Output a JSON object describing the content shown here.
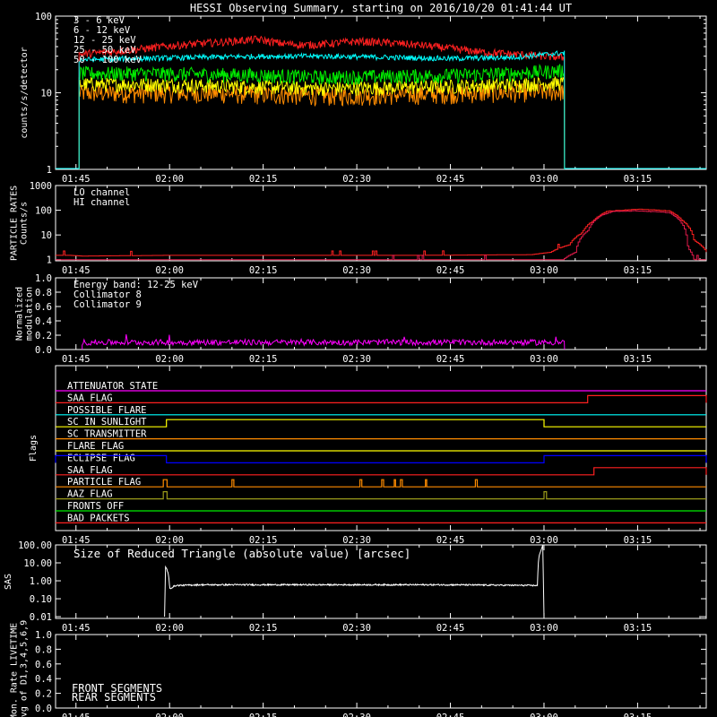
{
  "title": "HESSI Observing Summary, starting on 2016/10/20 01:41:44 UT",
  "colors": {
    "red": "#ff2020",
    "orange": "#ff8c00",
    "yellow": "#ffff00",
    "green": "#00ee00",
    "cyan": "#00ffff",
    "magenta": "#ff00ff",
    "blue": "#0000ff",
    "olive": "#9a9a1a",
    "crimson": "#e01a4a",
    "white": "#ffffff"
  },
  "time_axis": {
    "ticks": [
      "01:45",
      "02:00",
      "02:15",
      "02:30",
      "02:45",
      "03:00",
      "03:15"
    ],
    "tick_minutes": [
      105,
      120,
      135,
      150,
      165,
      180,
      195
    ],
    "range_minutes": [
      101.73,
      206
    ]
  },
  "chart_data": [
    {
      "id": "count-rates",
      "type": "line",
      "ylabel": "counts/s/detector",
      "yscale": "log",
      "ylim": [
        1,
        100
      ],
      "yticks": [
        "100",
        "10",
        "1"
      ],
      "yvals": [
        100,
        10,
        1
      ],
      "observing_window": [
        105.5,
        183.3
      ],
      "series": [
        {
          "name": "3 - 6 keV",
          "color": "red",
          "x": [
            106,
            110,
            115,
            120,
            125,
            130,
            134,
            138,
            142,
            146,
            150,
            155,
            160,
            165,
            170,
            175,
            180,
            183
          ],
          "y": [
            32,
            34,
            37,
            41,
            44,
            47,
            50,
            44,
            42,
            44,
            47,
            45,
            42,
            38,
            34,
            32,
            30,
            29
          ]
        },
        {
          "name": "6 - 12 keV",
          "color": "orange",
          "x": [
            106,
            115,
            125,
            135,
            145,
            155,
            165,
            175,
            183
          ],
          "y": [
            10,
            10,
            10,
            9.6,
            9.2,
            9.4,
            9.8,
            10.2,
            10.5
          ]
        },
        {
          "name": "12 - 25 keV",
          "color": "yellow",
          "x": [
            106,
            115,
            125,
            135,
            145,
            155,
            165,
            175,
            183
          ],
          "y": [
            13,
            13,
            12.5,
            12,
            11.5,
            11.8,
            12.2,
            12.8,
            13.5
          ]
        },
        {
          "name": "25 - 50 keV",
          "color": "green",
          "x": [
            106,
            115,
            125,
            135,
            145,
            155,
            165,
            175,
            183
          ],
          "y": [
            18,
            18,
            17.5,
            17,
            16,
            16.5,
            17,
            18,
            19.5
          ]
        },
        {
          "name": "50 - 100 keV",
          "color": "cyan",
          "x": [
            106,
            115,
            125,
            135,
            145,
            155,
            165,
            175,
            183
          ],
          "y": [
            27,
            28,
            29,
            30,
            30,
            29,
            28,
            29,
            33
          ]
        }
      ]
    },
    {
      "id": "particle-rates",
      "type": "line",
      "ylabel": "PARTICLE RATES Counts/s",
      "yscale": "log",
      "ylim": [
        0.9,
        1000
      ],
      "yticks": [
        "1000",
        "100",
        "10",
        "1"
      ],
      "yvals": [
        1000,
        100,
        10,
        1
      ],
      "series": [
        {
          "name": "LO channel",
          "color": "red",
          "x": [
            101.73,
            104,
            106,
            120,
            140,
            160,
            178,
            181,
            184,
            186,
            188,
            190,
            195,
            200,
            202,
            204,
            206
          ],
          "y": [
            1.5,
            1.5,
            1.4,
            1.5,
            1.5,
            1.5,
            1.6,
            2,
            4,
            12,
            40,
            90,
            110,
            95,
            40,
            6,
            2
          ]
        },
        {
          "name": "HI channel",
          "color": "crimson",
          "x": [
            101.73,
            104,
            106,
            120,
            140,
            160,
            180,
            183,
            185,
            187,
            189,
            191,
            195,
            200,
            202,
            203,
            204,
            206
          ],
          "y": [
            1,
            1,
            1,
            1,
            1,
            1,
            1,
            1,
            2,
            15,
            60,
            90,
            95,
            80,
            30,
            3,
            1,
            1
          ]
        }
      ]
    },
    {
      "id": "modulation",
      "type": "line",
      "ylabel": "Normalized modulation",
      "ylim": [
        0,
        1
      ],
      "yticks": [
        "1.0",
        "0.8",
        "0.6",
        "0.4",
        "0.2",
        "0.0"
      ],
      "yvals": [
        1,
        0.8,
        0.6,
        0.4,
        0.2,
        0
      ],
      "annotation": "Energy band: 12-25 keV",
      "series": [
        {
          "name": "Collimator 8",
          "color": "cyan",
          "x": [],
          "y": []
        },
        {
          "name": "Collimator 9",
          "color": "magenta",
          "x": [
            106,
            183.3
          ],
          "y": [
            0.1,
            0.1
          ]
        }
      ]
    },
    {
      "id": "flags",
      "type": "line",
      "ylabel": "Flags",
      "flags": [
        {
          "name": "ATTENUATOR STATE",
          "color": "magenta",
          "segments": []
        },
        {
          "name": "SAA FLAG",
          "color": "red",
          "segments": [
            [
              187,
              206
            ]
          ]
        },
        {
          "name": "POSSIBLE FLARE",
          "color": "cyan",
          "segments": []
        },
        {
          "name": "SC IN SUNLIGHT",
          "color": "yellow",
          "segments": [
            [
              119.5,
              180
            ]
          ]
        },
        {
          "name": "SC TRANSMITTER",
          "color": "orange",
          "segments": []
        },
        {
          "name": "FLARE FLAG",
          "color": "yellow",
          "segments": []
        },
        {
          "name": "ECLIPSE FLAG",
          "color": "blue",
          "segments": [
            [
              101.73,
              119.5
            ],
            [
              180,
              206
            ]
          ]
        },
        {
          "name": "SAA FLAG",
          "color": "red",
          "segments": [
            [
              188,
              206
            ]
          ]
        },
        {
          "name": "PARTICLE FLAG",
          "color": "orange",
          "segments": [
            [
              119,
              119.6
            ],
            [
              130,
              130.3
            ],
            [
              150.5,
              150.8
            ],
            [
              154,
              154.3
            ],
            [
              156,
              156.2
            ],
            [
              157,
              157.3
            ],
            [
              161,
              161.2
            ],
            [
              169,
              169.3
            ]
          ]
        },
        {
          "name": "AAZ FLAG",
          "color": "olive",
          "segments": [
            [
              119,
              119.6
            ],
            [
              180,
              180.4
            ]
          ]
        },
        {
          "name": "FRONTS OFF",
          "color": "green",
          "segments": []
        },
        {
          "name": "BAD PACKETS",
          "color": "red",
          "segments": []
        }
      ]
    },
    {
      "id": "sas",
      "type": "line",
      "ylabel": "SAS",
      "yscale": "log",
      "ylim": [
        0.008,
        100
      ],
      "yticks": [
        "100.00",
        "10.00",
        "1.00",
        "0.10",
        "0.01"
      ],
      "yvals": [
        100,
        10,
        1,
        0.1,
        0.01
      ],
      "series": [
        {
          "name": "Size of Reduced Triangle (absolute value) [arcsec]",
          "color": "white",
          "x": [
            119.3,
            119.5,
            120,
            121,
            125,
            135,
            150,
            165,
            179,
            180
          ],
          "y": [
            0.01,
            5,
            0.35,
            0.55,
            0.6,
            0.6,
            0.6,
            0.6,
            0.55,
            100
          ]
        }
      ]
    },
    {
      "id": "livetime",
      "type": "line",
      "ylabel": "Mon. Rate LIVETIME avg of D1,3,4,5,6,9",
      "ylim": [
        0,
        1
      ],
      "yticks": [
        "1.0",
        "0.8",
        "0.6",
        "0.4",
        "0.2",
        "0.0"
      ],
      "yvals": [
        1,
        0.8,
        0.6,
        0.4,
        0.2,
        0
      ],
      "series": [
        {
          "name": "FRONT SEGMENTS",
          "color": "green",
          "x": [],
          "y": []
        },
        {
          "name": "REAR SEGMENTS",
          "color": "olive",
          "x": [],
          "y": []
        }
      ]
    }
  ]
}
